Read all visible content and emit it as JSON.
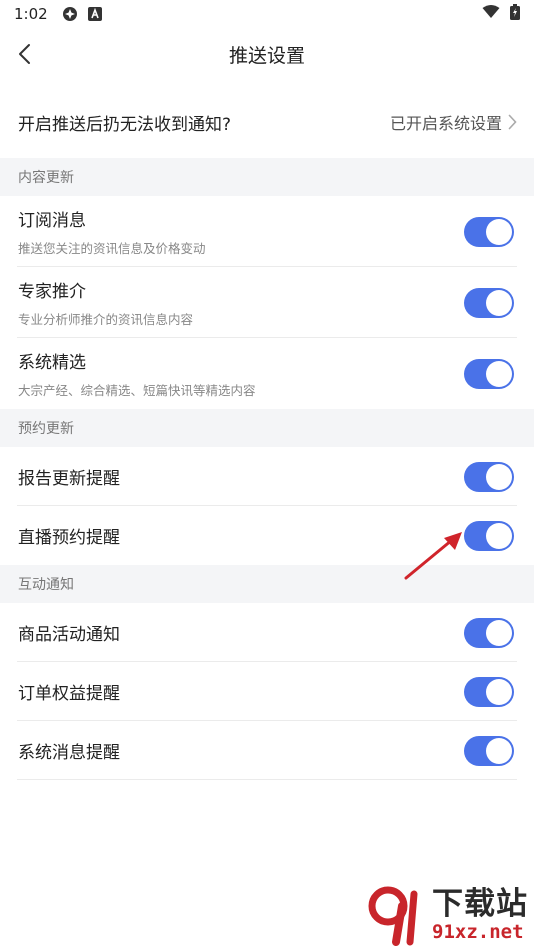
{
  "status_bar": {
    "time": "1:02"
  },
  "nav": {
    "title": "推送设置"
  },
  "push_row": {
    "question": "开启推送后扔无法收到通知?",
    "status": "已开启系统设置"
  },
  "sections": [
    {
      "header": "内容更新",
      "items": [
        {
          "label": "订阅消息",
          "desc": "推送您关注的资讯信息及价格变动",
          "on": true
        },
        {
          "label": "专家推介",
          "desc": "专业分析师推介的资讯信息内容",
          "on": true
        },
        {
          "label": "系统精选",
          "desc": "大宗产经、综合精选、短篇快讯等精选内容",
          "on": true
        }
      ]
    },
    {
      "header": "预约更新",
      "items": [
        {
          "label": "报告更新提醒",
          "on": true
        },
        {
          "label": "直播预约提醒",
          "on": true
        }
      ]
    },
    {
      "header": "互动通知",
      "items": [
        {
          "label": "商品活动通知",
          "on": true
        },
        {
          "label": "订单权益提醒",
          "on": true
        },
        {
          "label": "系统消息提醒",
          "on": true
        }
      ]
    }
  ],
  "watermark": {
    "title": "下载站",
    "url": "91xz.net"
  },
  "colors": {
    "toggle_on": "#4a72e8",
    "section_bg": "#f4f5f7",
    "annotation_arrow": "#d0242b"
  }
}
